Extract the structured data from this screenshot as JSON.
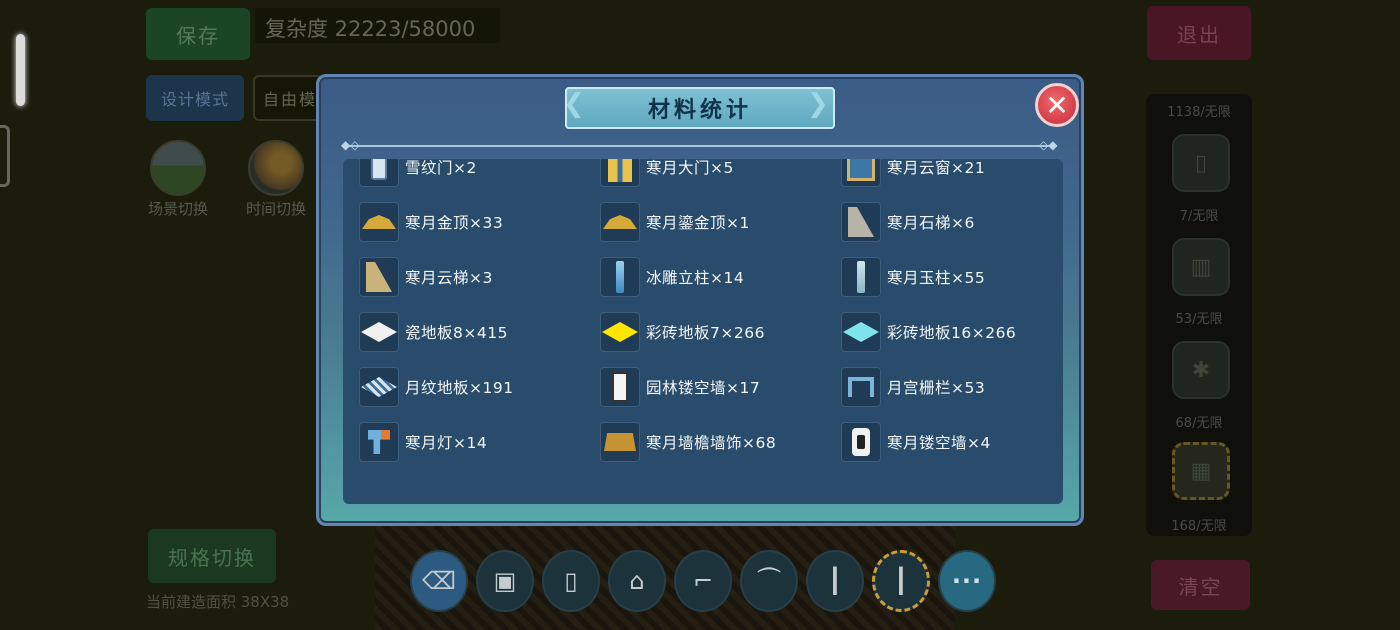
{
  "hud": {
    "save_label": "保存",
    "complexity_text": "复杂度 22223/58000",
    "exit_label": "退出",
    "design_mode_label": "设计模式",
    "free_label": "自由模",
    "scene_switch_label": "场景切换",
    "time_switch_label": "时间切换",
    "spec_switch_label": "规格切换",
    "build_area_label": "当前建造面积 38X38",
    "clear_label": "清空"
  },
  "inventory": {
    "counts": [
      "1138/无限",
      "7/无限",
      "53/无限",
      "68/无限",
      "168/无限"
    ]
  },
  "hotbar": {
    "more_label": "···"
  },
  "modal": {
    "title": "材料统计",
    "close_icon": "close-icon",
    "accent_color": "#5fa7c0",
    "close_color": "#d2313f",
    "items": [
      {
        "name": "雪纹门×2",
        "icon": "ic-door"
      },
      {
        "name": "寒月大门×5",
        "icon": "ic-gate"
      },
      {
        "name": "寒月云窗×21",
        "icon": "ic-window"
      },
      {
        "name": "寒月金顶×33",
        "icon": "ic-roof"
      },
      {
        "name": "寒月鎏金顶×1",
        "icon": "ic-roof"
      },
      {
        "name": "寒月石梯×6",
        "icon": "ic-stair"
      },
      {
        "name": "寒月云梯×3",
        "icon": "ic-cloudstair"
      },
      {
        "name": "冰雕立柱×14",
        "icon": "ic-pillar"
      },
      {
        "name": "寒月玉柱×55",
        "icon": "ic-pillar2"
      },
      {
        "name": "瓷地板8×415",
        "icon": "ic-tile-white"
      },
      {
        "name": "彩砖地板7×266",
        "icon": "ic-tile-yellow"
      },
      {
        "name": "彩砖地板16×266",
        "icon": "ic-tile-cyan"
      },
      {
        "name": "月纹地板×191",
        "icon": "ic-tile-moon"
      },
      {
        "name": "园林镂空墙×17",
        "icon": "ic-garden"
      },
      {
        "name": "月宫栅栏×53",
        "icon": "ic-fence"
      },
      {
        "name": "寒月灯×14",
        "icon": "ic-lamp"
      },
      {
        "name": "寒月墙檐墙饰×68",
        "icon": "ic-eave"
      },
      {
        "name": "寒月镂空墙×4",
        "icon": "ic-hollow"
      }
    ]
  }
}
